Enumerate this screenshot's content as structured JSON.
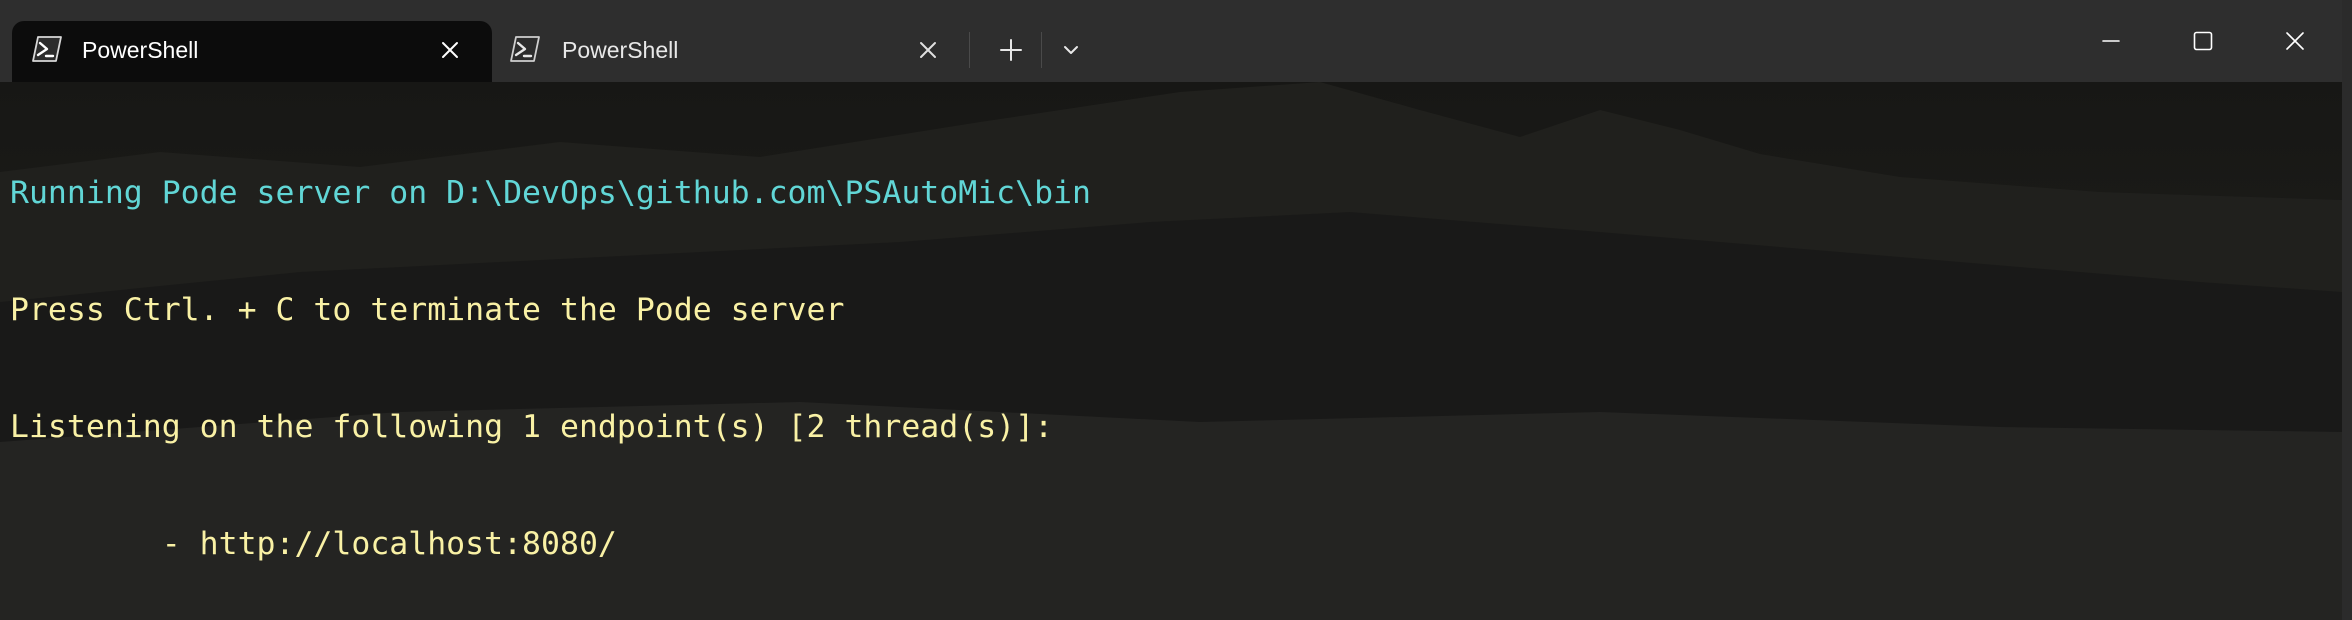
{
  "window": {
    "colors": {
      "titlebar_bg": "#2e2e2e",
      "active_tab_bg": "#0c0c0c",
      "cyan_text": "#61d6d6",
      "yellow_text": "#f9f1a5"
    }
  },
  "tabs": [
    {
      "label": "PowerShell",
      "active": true,
      "icon": "powershell-icon",
      "close_icon": "close-icon"
    },
    {
      "label": "PowerShell",
      "active": false,
      "icon": "powershell-icon",
      "close_icon": "close-icon"
    }
  ],
  "tab_actions": {
    "new_tab_icon": "plus-icon",
    "dropdown_icon": "chevron-down-icon"
  },
  "window_controls": {
    "minimize_icon": "minimize-icon",
    "maximize_icon": "maximize-icon",
    "close_icon": "close-icon"
  },
  "terminal": {
    "lines": [
      {
        "text": "Running Pode server on D:\\DevOps\\github.com\\PSAutoMic\\bin",
        "color": "cyan"
      },
      {
        "text": "Press Ctrl. + C to terminate the Pode server",
        "color": "yellow"
      },
      {
        "text": "Listening on the following 1 endpoint(s) [2 thread(s)]:",
        "color": "yellow"
      },
      {
        "text": "        - http://localhost:8080/",
        "color": "yellow"
      }
    ]
  }
}
